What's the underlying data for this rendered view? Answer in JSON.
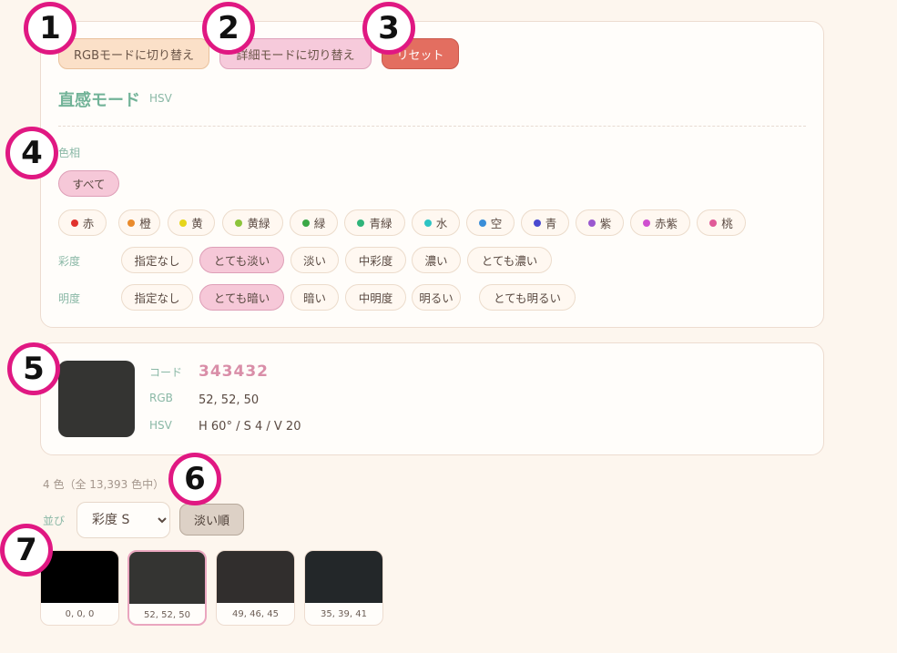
{
  "toolbar": {
    "rgb_mode_label": "RGBモードに切り替え",
    "detail_mode_label": "詳細モードに切り替え",
    "reset_label": "リセット"
  },
  "mode": {
    "title": "直感モード",
    "subtitle": "HSV"
  },
  "hue": {
    "label": "色相",
    "all_label": "すべて",
    "options": [
      {
        "label": "赤",
        "color": "#e0322e"
      },
      {
        "label": "橙",
        "color": "#e98a2b"
      },
      {
        "label": "黄",
        "color": "#e6d51a"
      },
      {
        "label": "黄緑",
        "color": "#8cc43b"
      },
      {
        "label": "緑",
        "color": "#3aa846"
      },
      {
        "label": "青緑",
        "color": "#2fb47a"
      },
      {
        "label": "水",
        "color": "#2dc4c4"
      },
      {
        "label": "空",
        "color": "#3a8ed8"
      },
      {
        "label": "青",
        "color": "#4a4ad0"
      },
      {
        "label": "紫",
        "color": "#9a58cf"
      },
      {
        "label": "赤紫",
        "color": "#cf4fcf"
      },
      {
        "label": "桃",
        "color": "#e05a98"
      }
    ]
  },
  "saturation": {
    "label": "彩度",
    "options": [
      "指定なし",
      "とても淡い",
      "淡い",
      "中彩度",
      "濃い",
      "とても濃い"
    ],
    "selected": "とても淡い"
  },
  "brightness": {
    "label": "明度",
    "options": [
      "指定なし",
      "とても暗い",
      "暗い",
      "中明度",
      "明るい",
      "とても明るい"
    ],
    "selected": "とても暗い"
  },
  "detail": {
    "code_label": "コード",
    "code_value": "343432",
    "rgb_label": "RGB",
    "rgb_value": "52, 52, 50",
    "hsv_label": "HSV",
    "hsv_value": "H 60° / S 4 / V 20",
    "swatch_color": "#343432"
  },
  "results": {
    "count_text": "4 色（全 13,393 色中）",
    "sort_label": "並び",
    "sort_value": "彩度 S",
    "sort_order_label": "淡い順"
  },
  "swatches": [
    {
      "label": "0, 0, 0",
      "color": "#000000"
    },
    {
      "label": "52, 52, 50",
      "color": "#343432"
    },
    {
      "label": "49, 46, 45",
      "color": "#312e2d"
    },
    {
      "label": "35, 39, 41",
      "color": "#232729"
    }
  ],
  "markers": [
    "1",
    "2",
    "3",
    "4",
    "5",
    "6",
    "7"
  ]
}
